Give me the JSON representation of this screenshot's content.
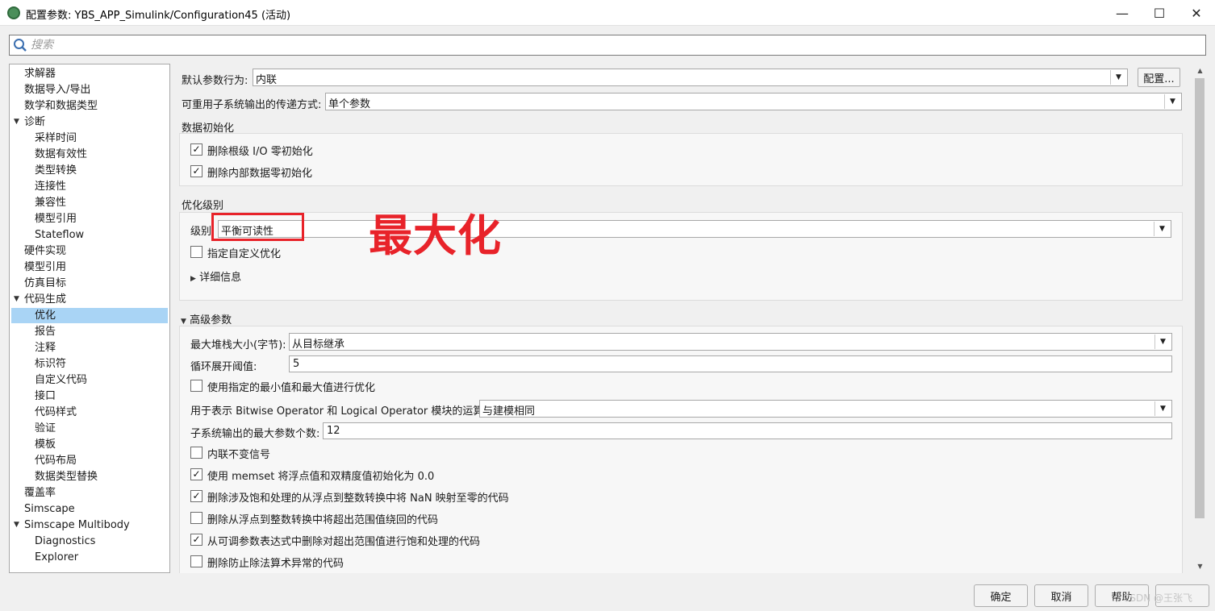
{
  "window": {
    "title": "配置参数: YBS_APP_Simulink/Configuration45 (活动)",
    "minimize": "—",
    "maximize": "☐",
    "close": "✕"
  },
  "search": {
    "placeholder": "搜索"
  },
  "tree": {
    "items": [
      {
        "label": "求解器"
      },
      {
        "label": "数据导入/导出"
      },
      {
        "label": "数学和数据类型"
      },
      {
        "label": "诊断"
      },
      {
        "label": "采样时间"
      },
      {
        "label": "数据有效性"
      },
      {
        "label": "类型转换"
      },
      {
        "label": "连接性"
      },
      {
        "label": "兼容性"
      },
      {
        "label": "模型引用"
      },
      {
        "label": "Stateflow"
      },
      {
        "label": "硬件实现"
      },
      {
        "label": "模型引用"
      },
      {
        "label": "仿真目标"
      },
      {
        "label": "代码生成"
      },
      {
        "label": "优化"
      },
      {
        "label": "报告"
      },
      {
        "label": "注释"
      },
      {
        "label": "标识符"
      },
      {
        "label": "自定义代码"
      },
      {
        "label": "接口"
      },
      {
        "label": "代码样式"
      },
      {
        "label": "验证"
      },
      {
        "label": "模板"
      },
      {
        "label": "代码布局"
      },
      {
        "label": "数据类型替换"
      },
      {
        "label": "覆盖率"
      },
      {
        "label": "Simscape"
      },
      {
        "label": "Simscape Multibody"
      },
      {
        "label": "Diagnostics"
      },
      {
        "label": "Explorer"
      }
    ]
  },
  "main": {
    "default_param_label": "默认参数行为:",
    "default_param_value": "内联",
    "config_button": "配置...",
    "reusable_label": "可重用子系统输出的传递方式:",
    "reusable_value": "单个参数",
    "data_init_title": "数据初始化",
    "data_init_cb1": "删除根级 I/O 零初始化",
    "data_init_cb2": "删除内部数据零初始化",
    "opt_level_title": "优化级别",
    "level_label": "级别",
    "level_value": "平衡可读性",
    "custom_opt_label": "指定自定义优化",
    "details_label": "详细信息",
    "advanced_title": "高级参数",
    "max_stack_label": "最大堆栈大小(字节):",
    "max_stack_value": "从目标继承",
    "loop_unroll_label": "循环展开阈值:",
    "loop_unroll_value": "5",
    "minmax_label": "使用指定的最小值和最大值进行优化",
    "bitwise_label": "用于表示 Bitwise Operator 和 Logical Operator 模块的运算符:",
    "bitwise_value": "与建模相同",
    "max_args_label": "子系统输出的最大参数个数:",
    "max_args_value": "12",
    "inline_invariant_label": "内联不变信号",
    "memset_label": "使用 memset 将浮点值和双精度值初始化为 0.0",
    "nan_label": "删除涉及饱和处理的从浮点到整数转换中将 NaN 映射至零的代码",
    "wrap_label": "删除从浮点到整数转换中将超出范围值绕回的代码",
    "saturation_label": "从可调参数表达式中删除对超出范围值进行饱和处理的代码",
    "div_label": "删除防止除法算术异常的代码"
  },
  "annotation": {
    "text": "最大化"
  },
  "footer": {
    "ok": "确定",
    "cancel": "取消",
    "help": "帮助",
    "watermark": "CSDN @王张飞"
  }
}
